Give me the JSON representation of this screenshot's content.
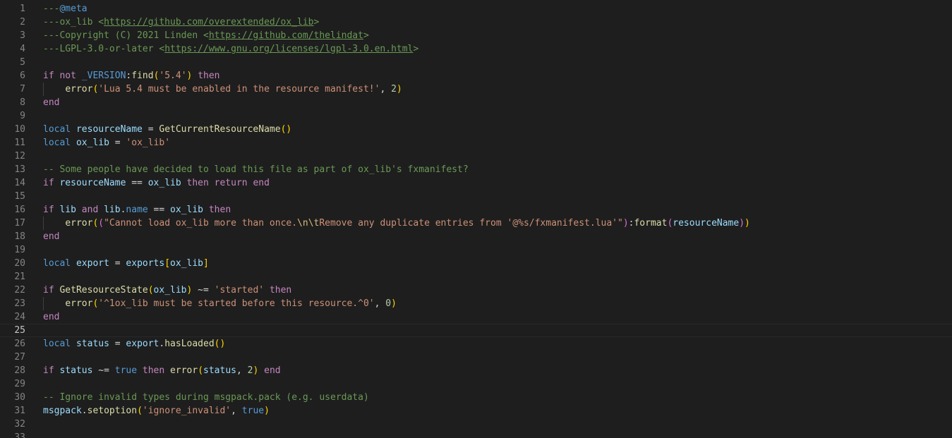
{
  "editor": {
    "lines": [
      {
        "n": "1",
        "tokens": [
          [
            "t-com",
            "---"
          ],
          [
            "t-tag",
            "@meta"
          ]
        ]
      },
      {
        "n": "2",
        "tokens": [
          [
            "t-com",
            "---ox_lib <"
          ],
          [
            "t-link",
            "https://github.com/overextended/ox_lib"
          ],
          [
            "t-com",
            ">"
          ]
        ]
      },
      {
        "n": "3",
        "tokens": [
          [
            "t-com",
            "---Copyright (C) 2021 Linden <"
          ],
          [
            "t-link",
            "https://github.com/thelindat"
          ],
          [
            "t-com",
            ">"
          ]
        ]
      },
      {
        "n": "4",
        "tokens": [
          [
            "t-com",
            "---LGPL-3.0-or-later <"
          ],
          [
            "t-link",
            "https://www.gnu.org/licenses/lgpl-3.0.en.html"
          ],
          [
            "t-com",
            ">"
          ]
        ]
      },
      {
        "n": "5",
        "tokens": []
      },
      {
        "n": "6",
        "tokens": [
          [
            "t-kw",
            "if"
          ],
          [
            "t-punc",
            " "
          ],
          [
            "t-kw",
            "not"
          ],
          [
            "t-punc",
            " "
          ],
          [
            "t-decl",
            "_VERSION"
          ],
          [
            "t-punc",
            ":"
          ],
          [
            "t-fn",
            "find"
          ],
          [
            "t-br1",
            "("
          ],
          [
            "t-str",
            "'5.4'"
          ],
          [
            "t-br1",
            ")"
          ],
          [
            "t-punc",
            " "
          ],
          [
            "t-kw",
            "then"
          ]
        ]
      },
      {
        "n": "7",
        "guide": true,
        "tokens": [
          [
            "t-punc",
            "    "
          ],
          [
            "t-fn",
            "error"
          ],
          [
            "t-br1",
            "("
          ],
          [
            "t-str",
            "'Lua 5.4 must be enabled in the resource manifest!'"
          ],
          [
            "t-punc",
            ", "
          ],
          [
            "t-num",
            "2"
          ],
          [
            "t-br1",
            ")"
          ]
        ]
      },
      {
        "n": "8",
        "tokens": [
          [
            "t-kw",
            "end"
          ]
        ]
      },
      {
        "n": "9",
        "tokens": []
      },
      {
        "n": "10",
        "tokens": [
          [
            "t-decl",
            "local"
          ],
          [
            "t-punc",
            " "
          ],
          [
            "t-var",
            "resourceName"
          ],
          [
            "t-punc",
            " = "
          ],
          [
            "t-fn",
            "GetCurrentResourceName"
          ],
          [
            "t-br1",
            "()"
          ]
        ]
      },
      {
        "n": "11",
        "tokens": [
          [
            "t-decl",
            "local"
          ],
          [
            "t-punc",
            " "
          ],
          [
            "t-var",
            "ox_lib"
          ],
          [
            "t-punc",
            " = "
          ],
          [
            "t-str",
            "'ox_lib'"
          ]
        ]
      },
      {
        "n": "12",
        "tokens": []
      },
      {
        "n": "13",
        "tokens": [
          [
            "t-com",
            "-- Some people have decided to load this file as part of ox_lib's fxmanifest?"
          ]
        ]
      },
      {
        "n": "14",
        "tokens": [
          [
            "t-kw",
            "if"
          ],
          [
            "t-punc",
            " "
          ],
          [
            "t-var",
            "resourceName"
          ],
          [
            "t-punc",
            " == "
          ],
          [
            "t-var",
            "ox_lib"
          ],
          [
            "t-punc",
            " "
          ],
          [
            "t-kw",
            "then"
          ],
          [
            "t-punc",
            " "
          ],
          [
            "t-kw",
            "return"
          ],
          [
            "t-punc",
            " "
          ],
          [
            "t-kw",
            "end"
          ]
        ]
      },
      {
        "n": "15",
        "tokens": []
      },
      {
        "n": "16",
        "tokens": [
          [
            "t-kw",
            "if"
          ],
          [
            "t-punc",
            " "
          ],
          [
            "t-var",
            "lib"
          ],
          [
            "t-punc",
            " "
          ],
          [
            "t-kw",
            "and"
          ],
          [
            "t-punc",
            " "
          ],
          [
            "t-var",
            "lib"
          ],
          [
            "t-punc",
            "."
          ],
          [
            "t-decl",
            "name"
          ],
          [
            "t-punc",
            " == "
          ],
          [
            "t-var",
            "ox_lib"
          ],
          [
            "t-punc",
            " "
          ],
          [
            "t-kw",
            "then"
          ]
        ]
      },
      {
        "n": "17",
        "guide": true,
        "tokens": [
          [
            "t-punc",
            "    "
          ],
          [
            "t-fn",
            "error"
          ],
          [
            "t-br1",
            "("
          ],
          [
            "t-br2",
            "("
          ],
          [
            "t-str",
            "\"Cannot load ox_lib more than once."
          ],
          [
            "t-esc",
            "\\n\\t"
          ],
          [
            "t-str",
            "Remove any duplicate entries from '@%s/fxmanifest.lua'\""
          ],
          [
            "t-br2",
            ")"
          ],
          [
            "t-punc",
            ":"
          ],
          [
            "t-fn",
            "format"
          ],
          [
            "t-br2",
            "("
          ],
          [
            "t-var",
            "resourceName"
          ],
          [
            "t-br2",
            ")"
          ],
          [
            "t-br1",
            ")"
          ]
        ]
      },
      {
        "n": "18",
        "tokens": [
          [
            "t-kw",
            "end"
          ]
        ]
      },
      {
        "n": "19",
        "tokens": []
      },
      {
        "n": "20",
        "tokens": [
          [
            "t-decl",
            "local"
          ],
          [
            "t-punc",
            " "
          ],
          [
            "t-var",
            "export"
          ],
          [
            "t-punc",
            " = "
          ],
          [
            "t-var",
            "exports"
          ],
          [
            "t-br1",
            "["
          ],
          [
            "t-var",
            "ox_lib"
          ],
          [
            "t-br1",
            "]"
          ]
        ]
      },
      {
        "n": "21",
        "tokens": []
      },
      {
        "n": "22",
        "tokens": [
          [
            "t-kw",
            "if"
          ],
          [
            "t-punc",
            " "
          ],
          [
            "t-fn",
            "GetResourceState"
          ],
          [
            "t-br1",
            "("
          ],
          [
            "t-var",
            "ox_lib"
          ],
          [
            "t-br1",
            ")"
          ],
          [
            "t-punc",
            " ~= "
          ],
          [
            "t-str",
            "'started'"
          ],
          [
            "t-punc",
            " "
          ],
          [
            "t-kw",
            "then"
          ]
        ]
      },
      {
        "n": "23",
        "guide": true,
        "tokens": [
          [
            "t-punc",
            "    "
          ],
          [
            "t-fn",
            "error"
          ],
          [
            "t-br1",
            "("
          ],
          [
            "t-str",
            "'^1ox_lib must be started before this resource.^0'"
          ],
          [
            "t-punc",
            ", "
          ],
          [
            "t-num",
            "0"
          ],
          [
            "t-br1",
            ")"
          ]
        ]
      },
      {
        "n": "24",
        "tokens": [
          [
            "t-kw",
            "end"
          ]
        ]
      },
      {
        "n": "25",
        "current": true,
        "tokens": []
      },
      {
        "n": "26",
        "tokens": [
          [
            "t-decl",
            "local"
          ],
          [
            "t-punc",
            " "
          ],
          [
            "t-var",
            "status"
          ],
          [
            "t-punc",
            " = "
          ],
          [
            "t-var",
            "export"
          ],
          [
            "t-punc",
            "."
          ],
          [
            "t-fn",
            "hasLoaded"
          ],
          [
            "t-br1",
            "()"
          ]
        ]
      },
      {
        "n": "27",
        "tokens": []
      },
      {
        "n": "28",
        "tokens": [
          [
            "t-kw",
            "if"
          ],
          [
            "t-punc",
            " "
          ],
          [
            "t-var",
            "status"
          ],
          [
            "t-punc",
            " ~= "
          ],
          [
            "t-decl",
            "true"
          ],
          [
            "t-punc",
            " "
          ],
          [
            "t-kw",
            "then"
          ],
          [
            "t-punc",
            " "
          ],
          [
            "t-fn",
            "error"
          ],
          [
            "t-br1",
            "("
          ],
          [
            "t-var",
            "status"
          ],
          [
            "t-punc",
            ", "
          ],
          [
            "t-num",
            "2"
          ],
          [
            "t-br1",
            ")"
          ],
          [
            "t-punc",
            " "
          ],
          [
            "t-kw",
            "end"
          ]
        ]
      },
      {
        "n": "29",
        "tokens": []
      },
      {
        "n": "30",
        "tokens": [
          [
            "t-com",
            "-- Ignore invalid types during msgpack.pack (e.g. userdata)"
          ]
        ]
      },
      {
        "n": "31",
        "tokens": [
          [
            "t-var",
            "msgpack"
          ],
          [
            "t-punc",
            "."
          ],
          [
            "t-fn",
            "setoption"
          ],
          [
            "t-br1",
            "("
          ],
          [
            "t-str",
            "'ignore_invalid'"
          ],
          [
            "t-punc",
            ", "
          ],
          [
            "t-decl",
            "true"
          ],
          [
            "t-br1",
            ")"
          ]
        ]
      },
      {
        "n": "32",
        "tokens": []
      },
      {
        "n": "33",
        "tokens": []
      }
    ]
  }
}
